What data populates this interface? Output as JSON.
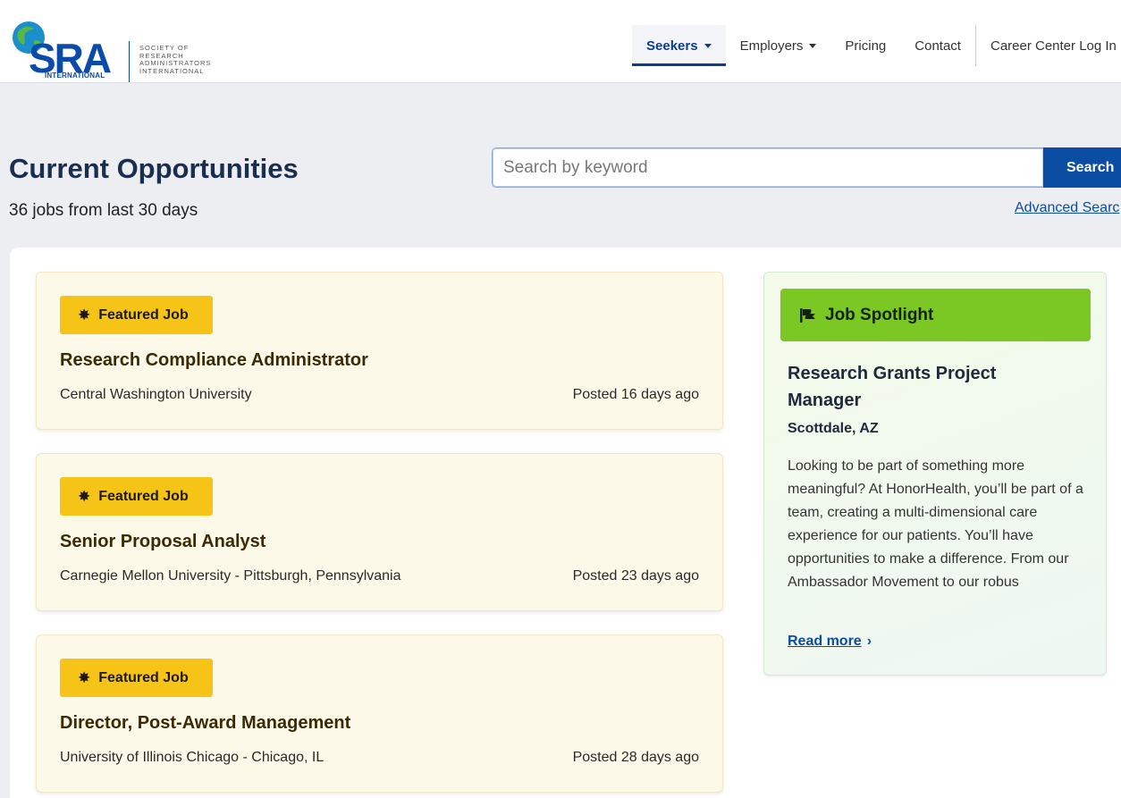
{
  "logo": {
    "mark": "SRA",
    "intl": "INTERNATIONAL",
    "society_lines": [
      "SOCIETY OF",
      "RESEARCH",
      "ADMINISTRATORS",
      "INTERNATIONAL"
    ]
  },
  "nav": {
    "items": [
      {
        "label": "Seekers",
        "active": true,
        "dropdown": true
      },
      {
        "label": "Employers",
        "active": false,
        "dropdown": true
      },
      {
        "label": "Pricing",
        "active": false,
        "dropdown": false
      },
      {
        "label": "Contact",
        "active": false,
        "dropdown": false
      },
      {
        "label": "Career Center Log In",
        "active": false,
        "dropdown": false
      }
    ]
  },
  "hero": {
    "title": "Current Opportunities",
    "job_count": "36 jobs from last 30 days",
    "search_placeholder": "Search by keyword",
    "search_button": "Search",
    "advanced_search": "Advanced Searc"
  },
  "jobs": [
    {
      "badge": "Featured Job",
      "title": "Research Compliance Administrator",
      "company": "Central Washington University",
      "posted": "Posted 16 days ago"
    },
    {
      "badge": "Featured Job",
      "title": "Senior Proposal Analyst",
      "company": "Carnegie Mellon University - Pittsburgh, Pennsylvania",
      "posted": "Posted 23 days ago"
    },
    {
      "badge": "Featured Job",
      "title": "Director, Post-Award Management",
      "company": "University of Illinois Chicago - Chicago, IL",
      "posted": "Posted 28 days ago"
    }
  ],
  "spotlight": {
    "heading": "Job Spotlight",
    "title": "Research Grants Project Manager",
    "location": "Scottdale, AZ",
    "description": "Looking to be part of something more meaningful? At HonorHealth, you’ll be part of a team, creating a multi-dimensional care experience for our patients. You’ll have opportunities to make a difference. From our Ambassador Movement to our robus",
    "read_more": "Read more"
  },
  "colors": {
    "brand_blue": "#0b4da3",
    "featured_yellow": "#f6c417",
    "spotlight_green": "#7bc723",
    "card_bg": "#fdf9e9"
  },
  "icons": {
    "badge": "badge-star-icon",
    "spotlight": "flag-icon",
    "read_more": "chevron-right-icon",
    "nav_dropdown": "caret-down-icon"
  }
}
